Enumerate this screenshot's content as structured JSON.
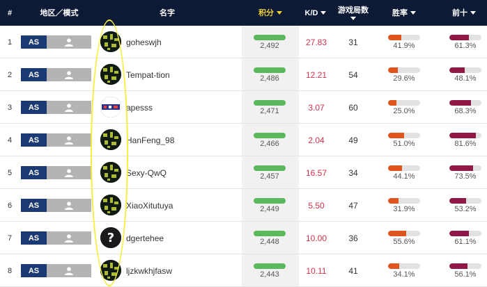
{
  "header": {
    "rank": "#",
    "region_mode": "地区／模式",
    "name": "名字",
    "score": "积分",
    "kd": "K/D",
    "games": "游戏局数",
    "win_rate": "胜率",
    "top10": "前十"
  },
  "colors": {
    "header_bg": "#0d1a36",
    "sort_active": "#f2d23a",
    "score_bar": "#5cb85c",
    "win_bar": "#e0541d",
    "top10_bar": "#8f1846",
    "kd_text": "#d0314b",
    "region_badge": "#1b3a73"
  },
  "players": [
    {
      "rank": "1",
      "region": "AS",
      "mode_icon": "person-icon",
      "avatar": "pattern-avatar",
      "name": "goheswjh",
      "score": "2,492",
      "score_value": 2492,
      "kd": "27.83",
      "games": "31",
      "win_rate": "41.9%",
      "win_value": 0.419,
      "top10": "61.3%",
      "top10_value": 0.613
    },
    {
      "rank": "2",
      "region": "AS",
      "mode_icon": "person-icon",
      "avatar": "pattern-avatar",
      "name": "Tempat-tion",
      "score": "2,486",
      "score_value": 2486,
      "kd": "12.21",
      "games": "54",
      "win_rate": "29.6%",
      "win_value": 0.296,
      "top10": "48.1%",
      "top10_value": 0.481
    },
    {
      "rank": "3",
      "region": "AS",
      "mode_icon": "person-icon",
      "avatar": "logo-avatar",
      "name": "apesss",
      "score": "2,471",
      "score_value": 2471,
      "kd": "3.07",
      "games": "60",
      "win_rate": "25.0%",
      "win_value": 0.25,
      "top10": "68.3%",
      "top10_value": 0.683
    },
    {
      "rank": "4",
      "region": "AS",
      "mode_icon": "person-icon",
      "avatar": "pattern-avatar",
      "name": "HanFeng_98",
      "score": "2,466",
      "score_value": 2466,
      "kd": "2.04",
      "games": "49",
      "win_rate": "51.0%",
      "win_value": 0.51,
      "top10": "81.6%",
      "top10_value": 0.816
    },
    {
      "rank": "5",
      "region": "AS",
      "mode_icon": "person-icon",
      "avatar": "pattern-avatar",
      "name": "Sexy-QwQ",
      "score": "2,457",
      "score_value": 2457,
      "kd": "16.57",
      "games": "34",
      "win_rate": "44.1%",
      "win_value": 0.441,
      "top10": "73.5%",
      "top10_value": 0.735
    },
    {
      "rank": "6",
      "region": "AS",
      "mode_icon": "person-icon",
      "avatar": "pattern-avatar",
      "name": "XiaoXitutuya",
      "score": "2,449",
      "score_value": 2449,
      "kd": "5.50",
      "games": "47",
      "win_rate": "31.9%",
      "win_value": 0.319,
      "top10": "53.2%",
      "top10_value": 0.532
    },
    {
      "rank": "7",
      "region": "AS",
      "mode_icon": "person-icon",
      "avatar": "unknown-avatar",
      "name": "dgertehee",
      "score": "2,448",
      "score_value": 2448,
      "kd": "10.00",
      "games": "36",
      "win_rate": "55.6%",
      "win_value": 0.556,
      "top10": "61.1%",
      "top10_value": 0.611
    },
    {
      "rank": "8",
      "region": "AS",
      "mode_icon": "person-icon",
      "avatar": "pattern-avatar",
      "name": "ljzkwkhjfasw",
      "score": "2,443",
      "score_value": 2443,
      "kd": "10.11",
      "games": "41",
      "win_rate": "34.1%",
      "win_value": 0.341,
      "top10": "56.1%",
      "top10_value": 0.561
    }
  ]
}
